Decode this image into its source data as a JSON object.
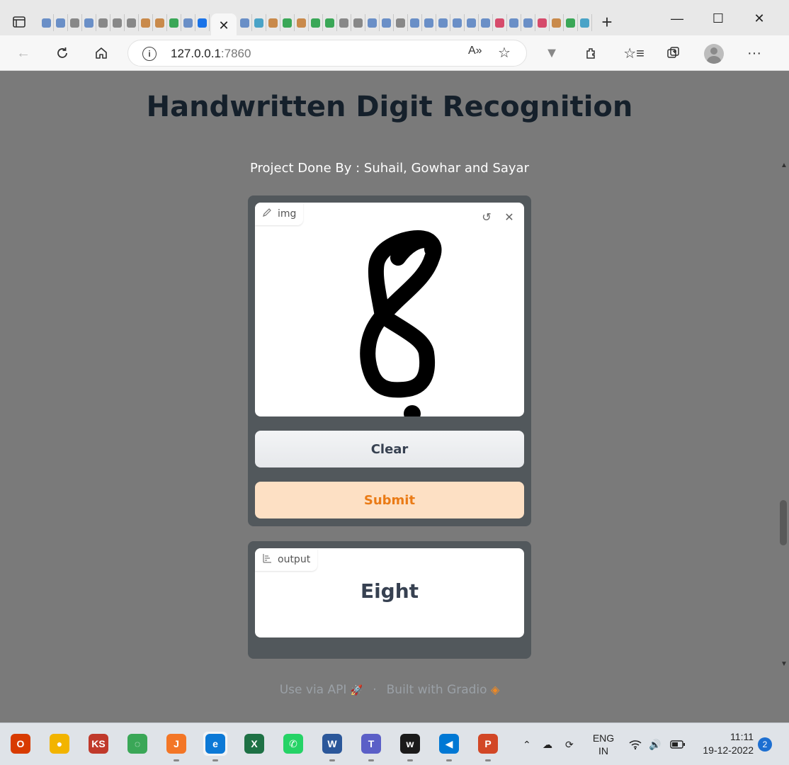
{
  "browser": {
    "active_tab_close": "✕",
    "new_tab": "+",
    "url_host": "127.0.0.1",
    "url_port": ":7860",
    "window_controls": [
      "—",
      "☐",
      "✕"
    ],
    "favicon_colors": [
      "#6a8fc7",
      "#6a8fc7",
      "#888888",
      "#6a8fc7",
      "#888888",
      "#888888",
      "#888888",
      "#c98a4b",
      "#c98a4b",
      "#3aa757",
      "#6a8fc7",
      "#1a73e8",
      "#6a8fc7",
      "#4aa3c7",
      "#c98a4b",
      "#3aa757",
      "#c98a4b",
      "#3aa757",
      "#3aa757",
      "#888888",
      "#888888",
      "#6a8fc7",
      "#6a8fc7",
      "#888888",
      "#6a8fc7",
      "#6a8fc7",
      "#6a8fc7",
      "#6a8fc7",
      "#6a8fc7",
      "#6a8fc7",
      "#d64b6b",
      "#6a8fc7",
      "#6a8fc7",
      "#d64b6b",
      "#c98a4b",
      "#3aa757",
      "#4aa3c7"
    ]
  },
  "app": {
    "title": "Handwritten Digit Recognition",
    "subtitle": "Project Done By : Suhail, Gowhar and Sayar",
    "input_label": "img",
    "clear_label": "Clear",
    "submit_label": "Submit",
    "output_label": "output",
    "output_value": "Eight",
    "footer_api": "Use via API",
    "footer_sep": "·",
    "footer_built": "Built with Gradio"
  },
  "taskbar": {
    "apps": [
      {
        "name": "office",
        "glyph": "O",
        "color": "#d83b01"
      },
      {
        "name": "chrome",
        "glyph": "●",
        "color": "#f2b400"
      },
      {
        "name": "ks",
        "glyph": "KS",
        "color": "#c0392b"
      },
      {
        "name": "refresh",
        "glyph": "◌",
        "color": "#3aa757"
      },
      {
        "name": "jupyter",
        "glyph": "J",
        "color": "#f37626"
      },
      {
        "name": "edge",
        "glyph": "e",
        "color": "#0c79d6"
      },
      {
        "name": "excel",
        "glyph": "X",
        "color": "#1e7145"
      },
      {
        "name": "whatsapp",
        "glyph": "✆",
        "color": "#25d366"
      },
      {
        "name": "word",
        "glyph": "W",
        "color": "#2b579a"
      },
      {
        "name": "teams",
        "glyph": "T",
        "color": "#5b5fc7"
      },
      {
        "name": "webex",
        "glyph": "w",
        "color": "#1a1a1a"
      },
      {
        "name": "vscode",
        "glyph": "◀",
        "color": "#0078d4"
      },
      {
        "name": "powerpoint",
        "glyph": "P",
        "color": "#d24726"
      }
    ],
    "lang_top": "ENG",
    "lang_bottom": "IN",
    "time": "11:11",
    "date": "19-12-2022",
    "notifications": "2"
  }
}
